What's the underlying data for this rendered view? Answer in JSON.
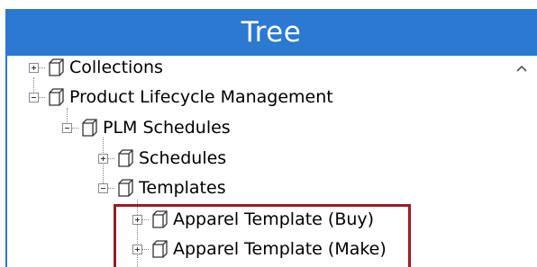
{
  "panel": {
    "title": "Tree"
  },
  "tree": {
    "nodes": [
      {
        "label": "Collections",
        "expanded": false,
        "icon": "cube-icon"
      },
      {
        "label": "Product Lifecycle Management",
        "expanded": true,
        "icon": "cube-icon"
      },
      {
        "label": "PLM Schedules",
        "expanded": true,
        "icon": "cube-icon"
      },
      {
        "label": "Schedules",
        "expanded": false,
        "icon": "cube-icon"
      },
      {
        "label": "Templates",
        "expanded": true,
        "icon": "cube-icon"
      },
      {
        "label": "Apparel Template (Buy)",
        "expanded": false,
        "icon": "cube-icon"
      },
      {
        "label": "Apparel Template (Make)",
        "expanded": false,
        "icon": "cube-icon"
      }
    ]
  },
  "colors": {
    "header_bg": "#2b79d0",
    "highlight_border": "#9b1b22"
  },
  "scrollbar": {
    "up_icon": "chevron-up-icon"
  }
}
